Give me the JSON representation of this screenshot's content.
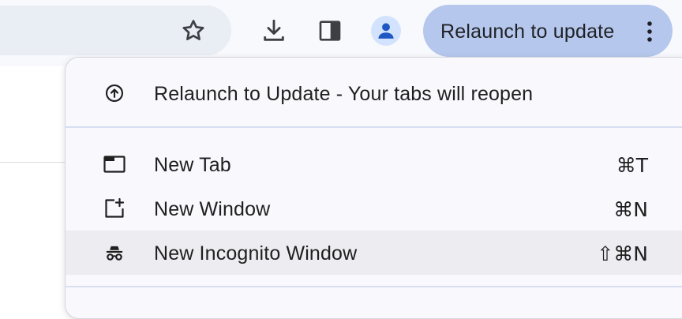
{
  "toolbar": {
    "bookmark_icon": "star-icon",
    "download_icon": "download-icon",
    "side_panel_icon": "side-panel-icon",
    "profile_icon": "person-icon",
    "relaunch_chip_label": "Relaunch to update",
    "menu_icon": "kebab-menu-icon"
  },
  "menu": {
    "items": [
      {
        "label": "Relaunch to Update - Your tabs will reopen",
        "icon": "relaunch-arrow-icon",
        "shortcut": ""
      },
      {
        "label": "New Tab",
        "icon": "new-tab-icon",
        "shortcut": "⌘T"
      },
      {
        "label": "New Window",
        "icon": "new-window-icon",
        "shortcut": "⌘N"
      },
      {
        "label": "New Incognito Window",
        "icon": "incognito-icon",
        "shortcut": "⇧⌘N"
      }
    ]
  },
  "colors": {
    "toolbar_bg": "#f8f9fc",
    "omnibox_bg": "#e9edf4",
    "chip_bg": "#b5c7ec",
    "menu_bg": "#f9f8fd",
    "menu_hover": "#ececf1",
    "avatar_bg": "#d3e3fd",
    "avatar_fg": "#1f57c3"
  }
}
